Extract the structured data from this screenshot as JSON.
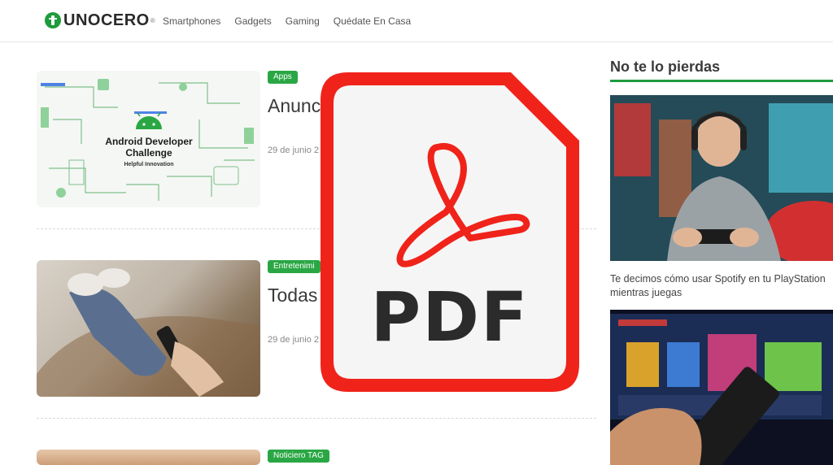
{
  "header": {
    "logo_text": "UNOCERO",
    "logo_mark": "®",
    "nav": [
      "Smartphones",
      "Gadgets",
      "Gaming",
      "Quédate En Casa"
    ]
  },
  "articles": [
    {
      "tag": "Apps",
      "title": "Anunc                                    o #And",
      "date": "29 de junio 2",
      "thumb_text": "Android Developer Challenge",
      "thumb_sub": "Helpful Innovation"
    },
    {
      "tag": "Entretenimi",
      "title": "Todas                                    n a Prim",
      "date": "29 de junio 2"
    },
    {
      "tag": "Noticiero TAG"
    }
  ],
  "sidebar": {
    "title": "No te lo pierdas",
    "caption": "Te decimos cómo usar Spotify en tu PlayStation mientras juegas"
  },
  "overlay": {
    "label": "PDF"
  },
  "colors": {
    "brand_green": "#1e9b3b",
    "tag_green": "#2aa744",
    "pdf_red": "#f0231a"
  }
}
